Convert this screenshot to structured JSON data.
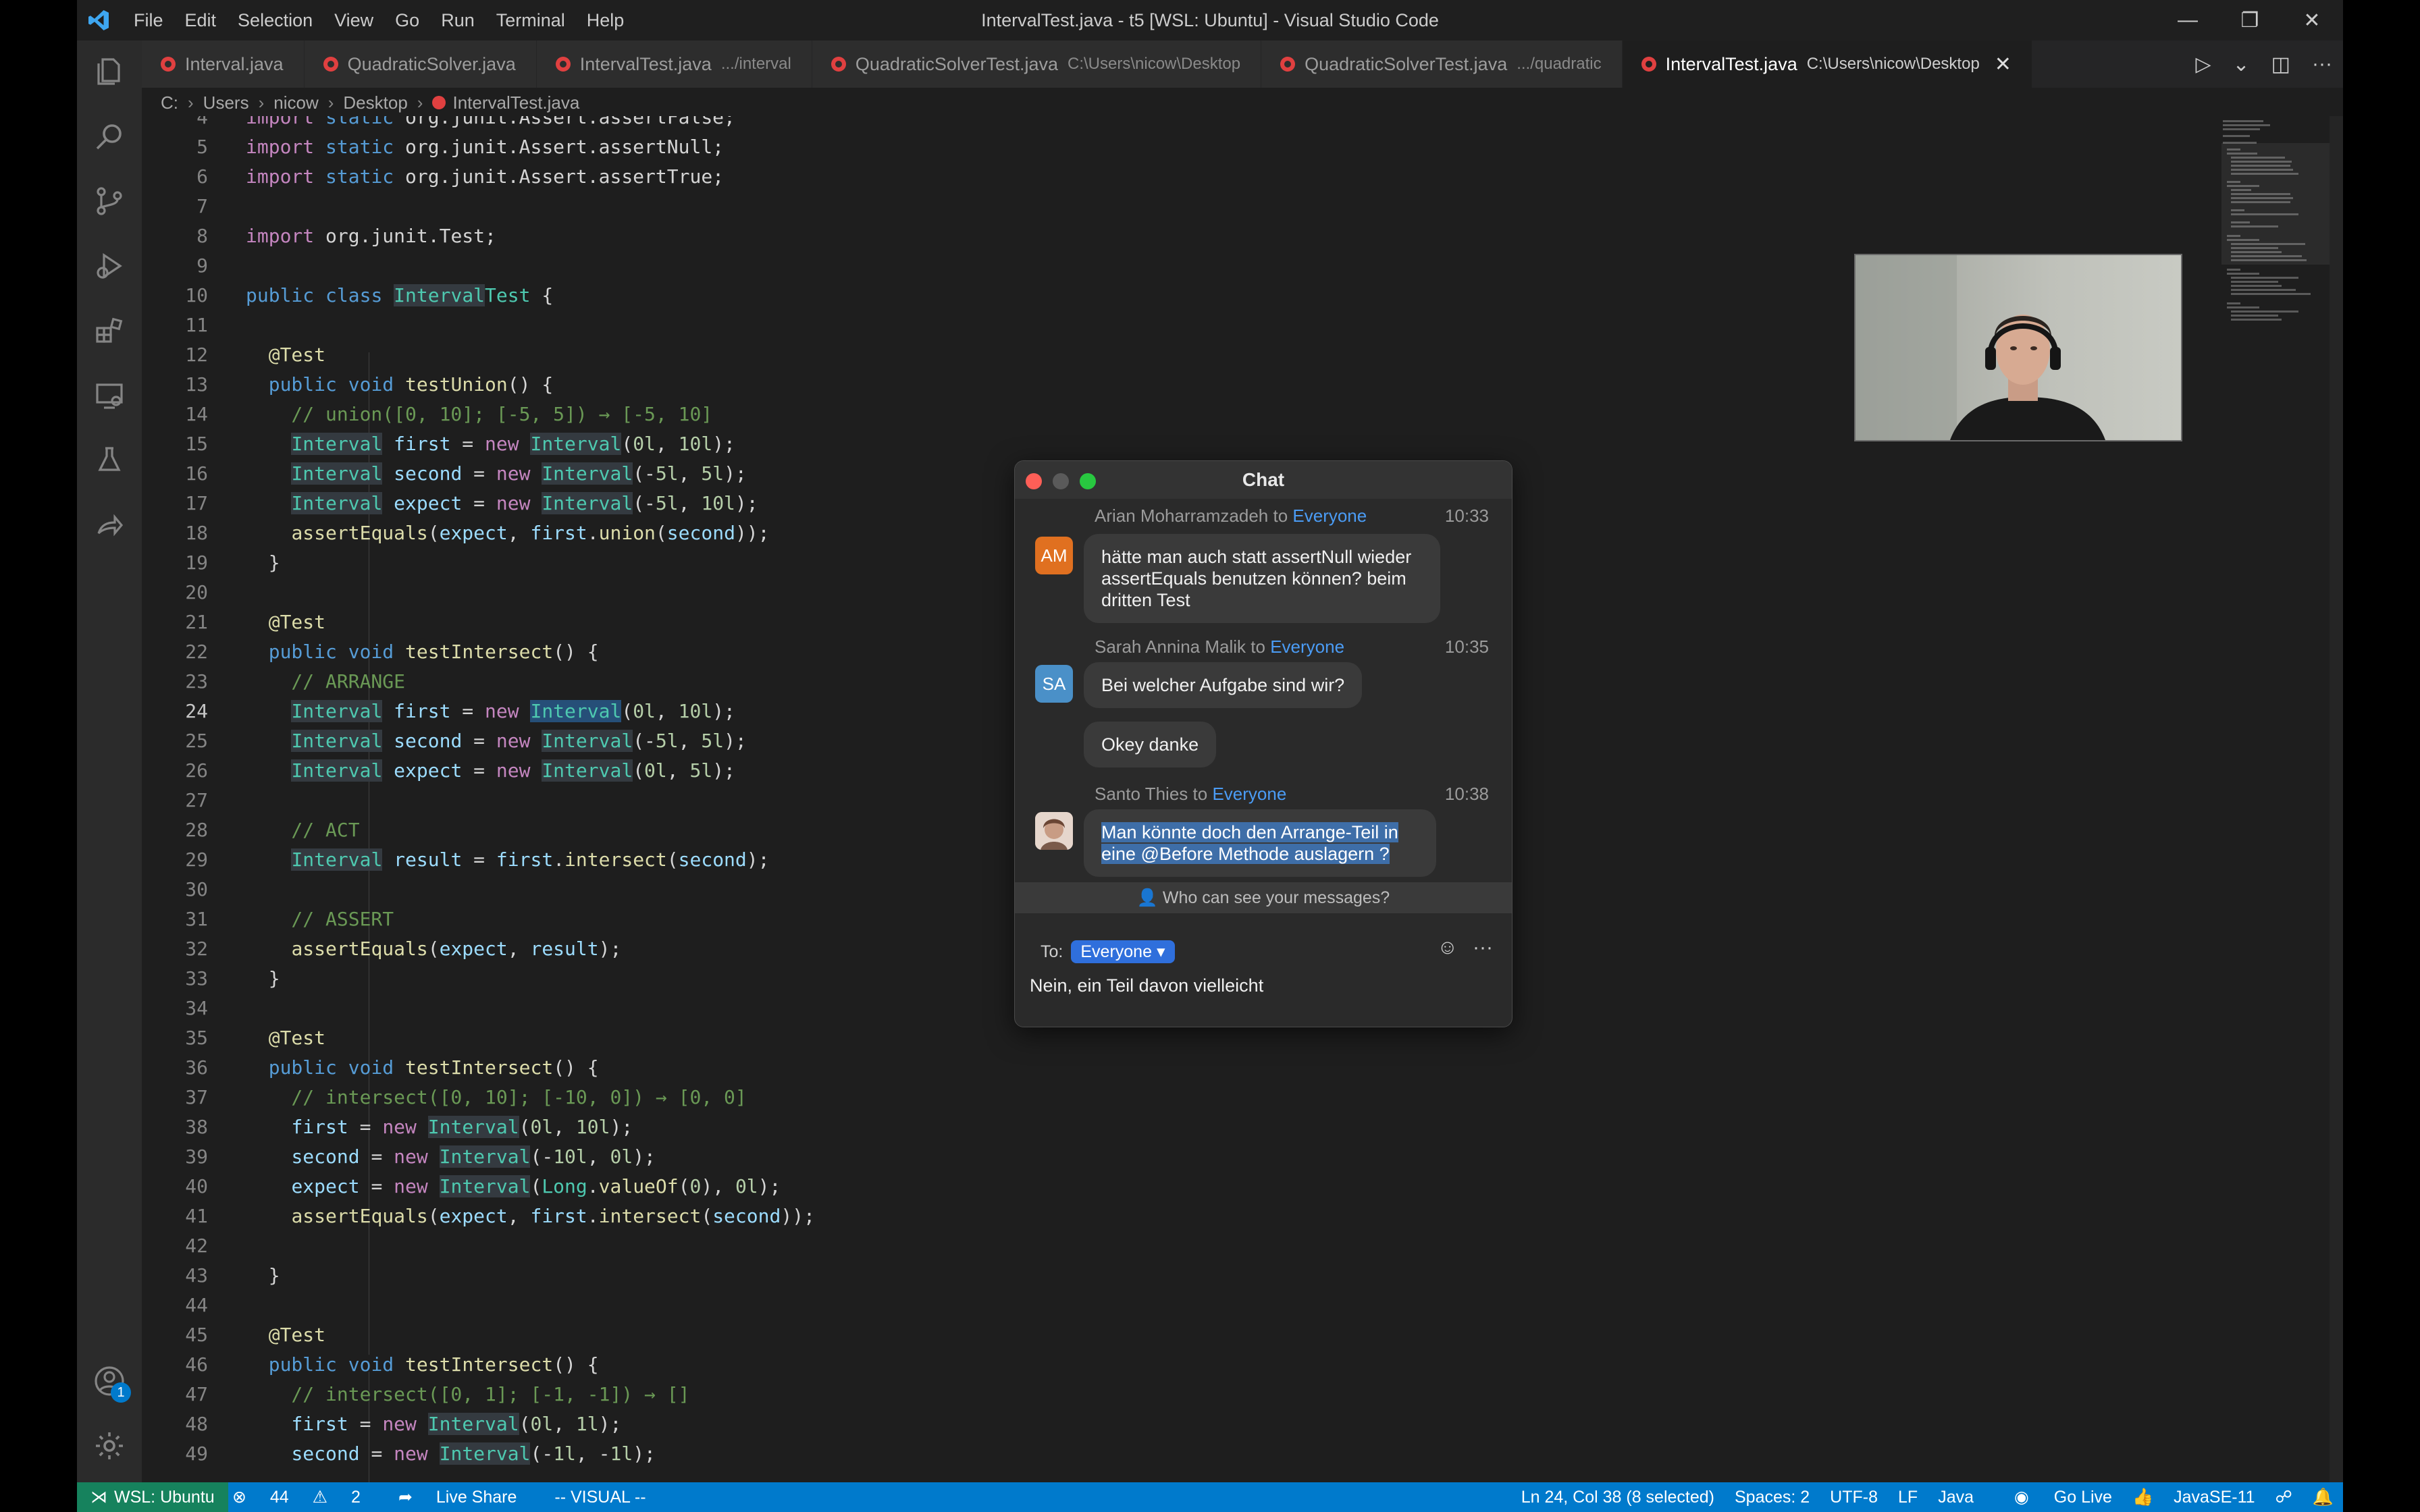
{
  "window": {
    "title": "IntervalTest.java - t5 [WSL: Ubuntu] - Visual Studio Code",
    "menu": [
      "File",
      "Edit",
      "Selection",
      "View",
      "Go",
      "Run",
      "Terminal",
      "Help"
    ]
  },
  "tabs": [
    {
      "label": "Interval.java",
      "desc": ""
    },
    {
      "label": "QuadraticSolver.java",
      "desc": ""
    },
    {
      "label": "IntervalTest.java",
      "desc": ".../interval"
    },
    {
      "label": "QuadraticSolverTest.java",
      "desc": "C:\\Users\\nicow\\Desktop"
    },
    {
      "label": "QuadraticSolverTest.java",
      "desc": ".../quadratic"
    },
    {
      "label": "IntervalTest.java",
      "desc": "C:\\Users\\nicow\\Desktop",
      "close": "✕"
    }
  ],
  "breadcrumb": [
    "C:",
    "Users",
    "nicow",
    "Desktop",
    "IntervalTest.java"
  ],
  "activity": {
    "account_badge": "1"
  },
  "editor": {
    "line_numbers": [
      "4",
      "5",
      "6",
      "7",
      "8",
      "9",
      "10",
      "11",
      "12",
      "13",
      "14",
      "15",
      "16",
      "17",
      "18",
      "19",
      "20",
      "21",
      "22",
      "23",
      "24",
      "25",
      "26",
      "27",
      "28",
      "29",
      "30",
      "31",
      "32",
      "33",
      "34",
      "35",
      "36",
      "37",
      "38",
      "39",
      "40",
      "41",
      "42",
      "43",
      "44",
      "45",
      "46",
      "47",
      "48",
      "49"
    ],
    "current_line": "24"
  },
  "chat": {
    "title": "Chat",
    "messages": [
      {
        "sender": "Arian Moharramzadeh",
        "to": "to",
        "recipient": "Everyone",
        "time": "10:33",
        "initials": "AM",
        "avatar_color": "#e07020",
        "bubbles": [
          "hätte man auch statt assertNull wieder",
          "assertEquals benutzen können? beim",
          "dritten Test"
        ]
      },
      {
        "sender": "Sarah Annina Malik",
        "to": "to",
        "recipient": "Everyone",
        "time": "10:35",
        "initials": "SA",
        "avatar_color": "#4a90c8",
        "bubbles": [
          "Bei welcher Aufgabe sind wir?",
          "Okey danke"
        ]
      },
      {
        "sender": "Santo Thies",
        "to": "to",
        "recipient": "Everyone",
        "time": "10:38",
        "bubbles": [
          "Man könnte doch den Arrange-Teil in",
          "eine @Before Methode auslagern ?"
        ]
      }
    ],
    "privacy_note": "Who can see your messages?",
    "to_label": "To:",
    "to_value": "Everyone",
    "input_value": "Nein, ein Teil davon vielleicht"
  },
  "statusbar": {
    "remote": "WSL: Ubuntu",
    "errors": "44",
    "warnings": "2",
    "live_share": "Live Share",
    "mode": "-- VISUAL --",
    "cursor": "Ln 24, Col 38 (8 selected)",
    "spaces": "Spaces: 2",
    "encoding": "UTF-8",
    "eol": "LF",
    "language": "Java",
    "go_live": "Go Live",
    "java_version": "JavaSE-11"
  },
  "colors": {
    "accent": "#007acc",
    "remote": "#16825d",
    "chat_link": "#4b9cf5"
  }
}
